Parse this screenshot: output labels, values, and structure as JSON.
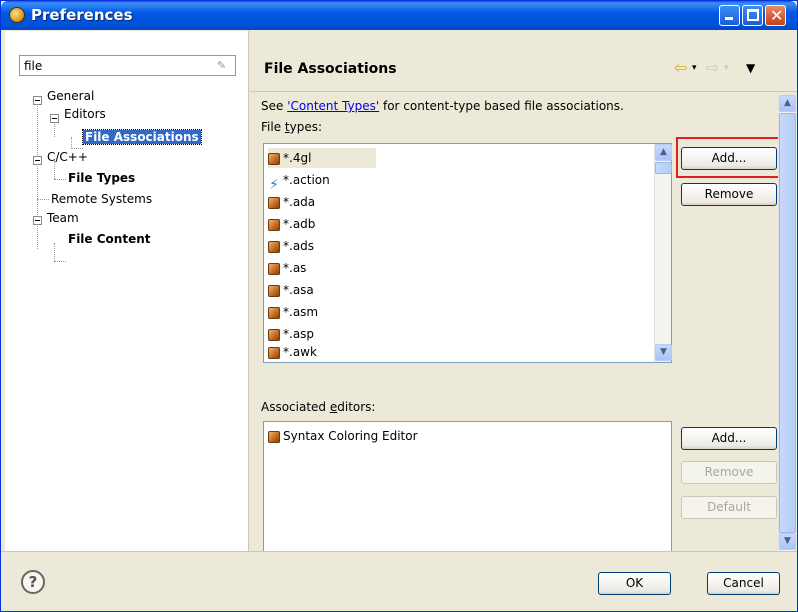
{
  "window": {
    "title": "Preferences"
  },
  "filter": {
    "value": "file"
  },
  "tree": {
    "general": "General",
    "editors": "Editors",
    "file_associations": "File Associations",
    "cpp": "C/C++",
    "file_types": "File Types",
    "remote_systems": "Remote Systems",
    "team": "Team",
    "file_content": "File Content"
  },
  "page": {
    "title": "File Associations",
    "see_prefix": "See ",
    "content_types_link": "'Content Types'",
    "see_suffix": " for content-type based file associations.",
    "file_types_label_pre": "File ",
    "file_types_label_u": "t",
    "file_types_label_post": "ypes:",
    "file_types": [
      "*.4gl",
      "*.action",
      "*.ada",
      "*.adb",
      "*.ads",
      "*.as",
      "*.asa",
      "*.asm",
      "*.asp",
      "*.awk"
    ],
    "assoc_label_pre": "Associated ",
    "assoc_label_u": "e",
    "assoc_label_post": "ditors:",
    "associated_editors": [
      "Syntax Coloring Editor"
    ],
    "buttons": {
      "add_top": "Add...",
      "remove_top": "Remove",
      "add_bottom": "Add...",
      "remove_bottom": "Remove",
      "default": "Default"
    }
  },
  "footer": {
    "ok": "OK",
    "cancel": "Cancel"
  }
}
